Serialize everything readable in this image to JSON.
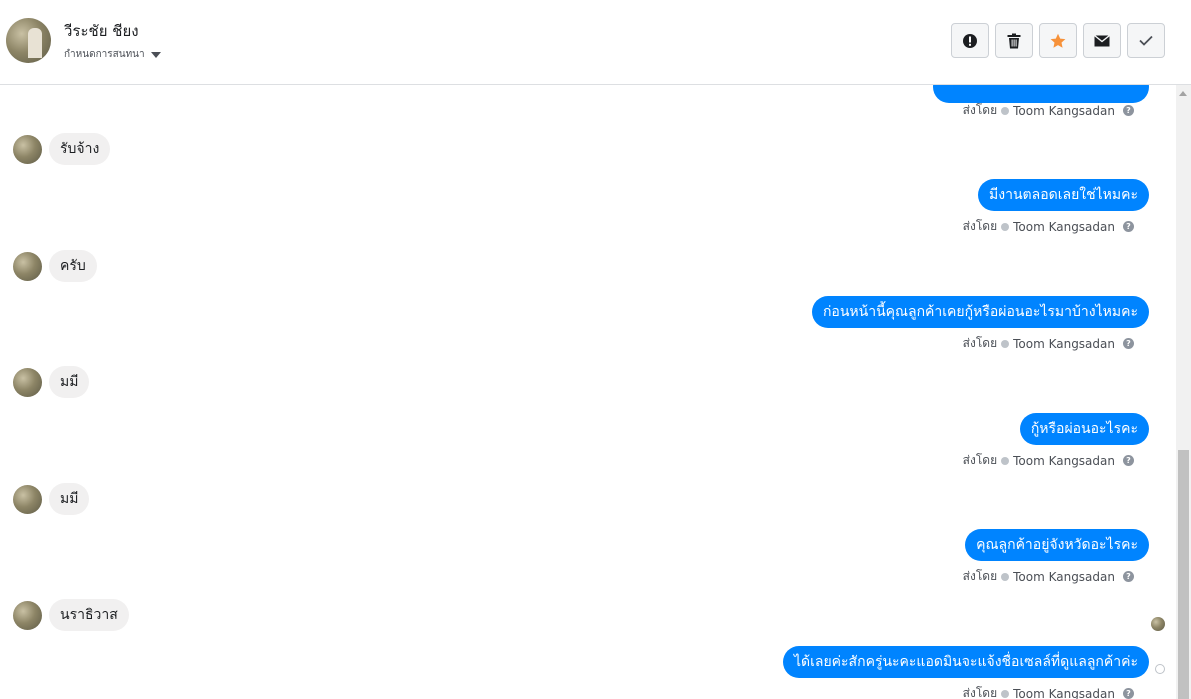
{
  "header": {
    "contact_name": "วีระชัย ชียง",
    "assign_label": "กำหนดการสนทนา",
    "toolbar": [
      {
        "name": "spam-button",
        "icon": "alert-icon"
      },
      {
        "name": "delete-button",
        "icon": "trash-icon"
      },
      {
        "name": "star-button",
        "icon": "star-icon",
        "color": "#f7923a"
      },
      {
        "name": "mark-unread-button",
        "icon": "envelope-icon"
      },
      {
        "name": "mark-done-button",
        "icon": "check-icon"
      }
    ]
  },
  "sent_by": {
    "prefix": "ส่งโดย",
    "agent": "Toom Kangsadan"
  },
  "messages": {
    "m0": {
      "text": ""
    },
    "m1": {
      "text": "รับจ้าง"
    },
    "m2": {
      "text": "มีงานตลอดเลยใช่ไหมคะ"
    },
    "m3": {
      "text": "ครับ"
    },
    "m4": {
      "text": "ก่อนหน้านี้คุณลูกค้าเคยกู้หรือผ่อนอะไรมาบ้างไหมคะ"
    },
    "m5": {
      "text": "มมี"
    },
    "m6": {
      "text": "กู้หรือผ่อนอะไรคะ"
    },
    "m7": {
      "text": "มมี"
    },
    "m8": {
      "text": "คุณลูกค้าอยู่จังหวัดอะไรคะ"
    },
    "m9": {
      "text": "นราธิวาส"
    },
    "m10": {
      "text": "ได้เลยค่ะสักครู่นะคะแอดมินจะแจ้งชื่อเซลล์ที่ดูแลลูกค้าค่ะ"
    }
  },
  "colors": {
    "outgoing_bubble": "#0084ff",
    "incoming_bubble": "#f1f0f0"
  }
}
